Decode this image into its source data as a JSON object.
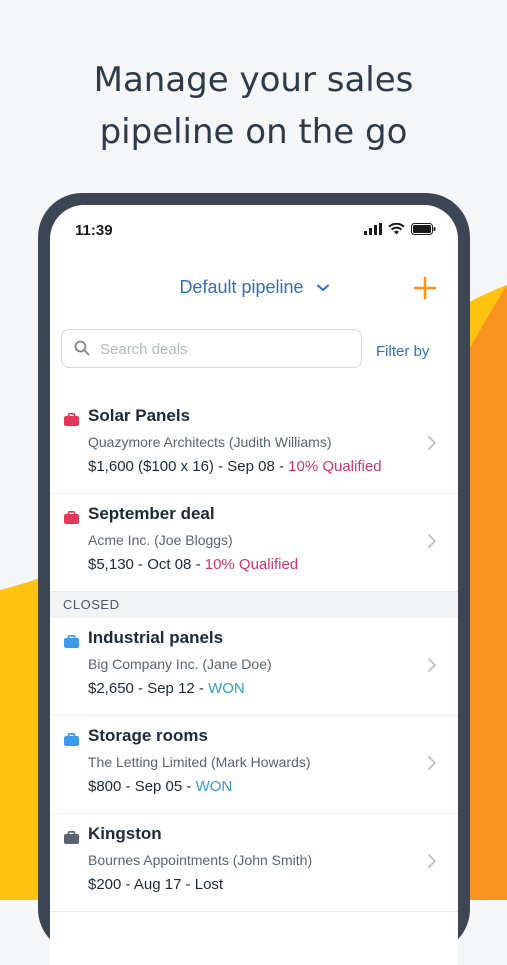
{
  "headline": {
    "line1": "Manage your sales",
    "line2": "pipeline on the go"
  },
  "colors": {
    "accent_orange": "#f7931e",
    "accent_yellow": "#ffc20e",
    "link_blue": "#2f6ec2"
  },
  "status_bar": {
    "time": "11:39"
  },
  "header": {
    "pipeline_label": "Default pipeline"
  },
  "search": {
    "placeholder": "Search deals",
    "value": ""
  },
  "filter_label": "Filter by",
  "open_deals": [
    {
      "title": "Solar Panels",
      "org": "Quazymore Architects (Judith Williams)",
      "meta": "$1,600 ($100 x 16) - Sep 08 - ",
      "status": "10% Qualified",
      "icon": "briefcase-icon-red",
      "icon_color": "#e0395a"
    },
    {
      "title": "September deal",
      "org": "Acme Inc. (Joe Bloggs)",
      "meta": "$5,130 - Oct 08 - ",
      "status": "10% Qualified",
      "icon": "briefcase-icon-red",
      "icon_color": "#e0395a"
    }
  ],
  "closed_section_label": "CLOSED",
  "closed_deals": [
    {
      "title": "Industrial panels",
      "org": "Big Company Inc. (Jane Doe)",
      "meta": "$2,650 - Sep 12 - ",
      "status": "WON",
      "icon": "briefcase-icon-blue",
      "icon_color": "#3d9ae8"
    },
    {
      "title": "Storage rooms",
      "org": "The Letting Limited (Mark Howards)",
      "meta": "$800 - Sep 05 - ",
      "status": "WON",
      "icon": "briefcase-icon-blue",
      "icon_color": "#3d9ae8"
    },
    {
      "title": "Kingston",
      "org": "Bournes Appointments (John Smith)",
      "meta": "$200 - Aug 17 - ",
      "status": "Lost",
      "icon": "briefcase-icon-gray",
      "icon_color": "#5a6470"
    }
  ]
}
